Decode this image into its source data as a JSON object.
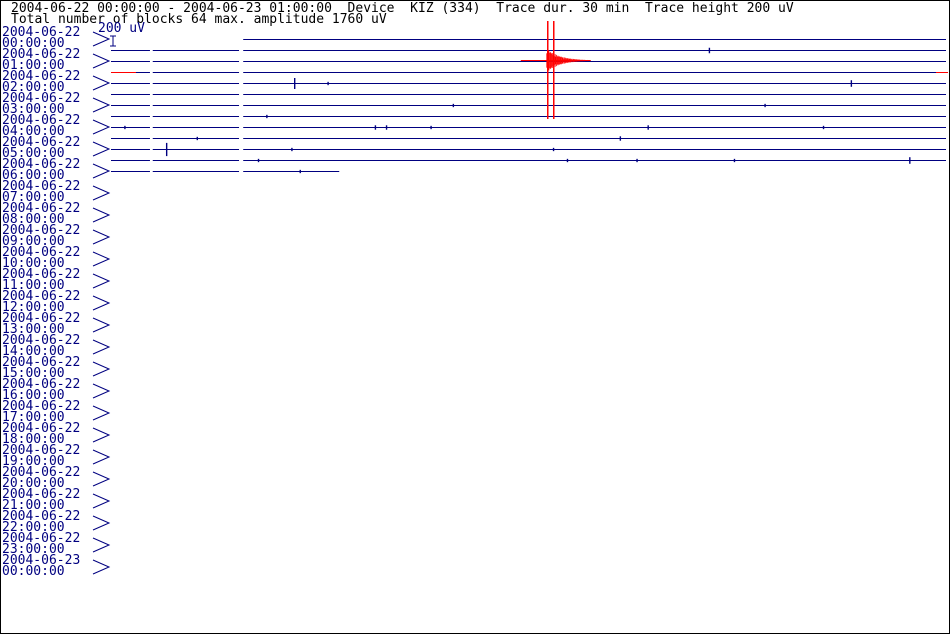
{
  "header": {
    "line1": "2004-06-22 00:00:00 - 2004-06-23 01:00:00  Device  KIZ (334)  Trace dur. 30 min  Trace height 200 uV",
    "line2": "Total number of blocks 64 max. amplitude 1760 uV",
    "scale_label": "200 uV"
  },
  "colors": {
    "trace": "#000080",
    "event": "#ff0000",
    "text": "#000080",
    "border": "#000000",
    "background": "#ffffff"
  },
  "chart_data": {
    "type": "line",
    "title": "2004-06-22 00:00:00 - 2004-06-23 01:00:00  Device  KIZ (334)  Trace dur. 30 min  Trace height 200 uV",
    "subtitle": "Total number of blocks 64 max. amplitude 1760 uV",
    "trace_duration_min": 30,
    "trace_height_uV": 200,
    "max_amplitude_uV": 1760,
    "total_blocks": 64,
    "x_range_min": [
      0,
      30
    ],
    "y_tick_labels": [
      {
        "date": "2004-06-22",
        "time": "00:00:00"
      },
      {
        "date": "2004-06-22",
        "time": "01:00:00"
      },
      {
        "date": "2004-06-22",
        "time": "02:00:00"
      },
      {
        "date": "2004-06-22",
        "time": "03:00:00"
      },
      {
        "date": "2004-06-22",
        "time": "04:00:00"
      },
      {
        "date": "2004-06-22",
        "time": "05:00:00"
      },
      {
        "date": "2004-06-22",
        "time": "06:00:00"
      },
      {
        "date": "2004-06-22",
        "time": "07:00:00"
      },
      {
        "date": "2004-06-22",
        "time": "08:00:00"
      },
      {
        "date": "2004-06-22",
        "time": "09:00:00"
      },
      {
        "date": "2004-06-22",
        "time": "10:00:00"
      },
      {
        "date": "2004-06-22",
        "time": "11:00:00"
      },
      {
        "date": "2004-06-22",
        "time": "12:00:00"
      },
      {
        "date": "2004-06-22",
        "time": "13:00:00"
      },
      {
        "date": "2004-06-22",
        "time": "14:00:00"
      },
      {
        "date": "2004-06-22",
        "time": "15:00:00"
      },
      {
        "date": "2004-06-22",
        "time": "16:00:00"
      },
      {
        "date": "2004-06-22",
        "time": "17:00:00"
      },
      {
        "date": "2004-06-22",
        "time": "18:00:00"
      },
      {
        "date": "2004-06-22",
        "time": "19:00:00"
      },
      {
        "date": "2004-06-22",
        "time": "20:00:00"
      },
      {
        "date": "2004-06-22",
        "time": "21:00:00"
      },
      {
        "date": "2004-06-22",
        "time": "22:00:00"
      },
      {
        "date": "2004-06-22",
        "time": "23:00:00"
      },
      {
        "date": "2004-06-23",
        "time": "00:00:00"
      }
    ],
    "traces": [
      {
        "start_hour": 0.0,
        "end_min": 30,
        "gaps_min": [
          [
            0.0,
            30.0
          ]
        ],
        "spikes": [],
        "event": false
      },
      {
        "start_hour": 0.5,
        "end_min": 30,
        "gaps_min": [],
        "spikes": [
          {
            "t_min": 21.5,
            "amp": 0.25
          }
        ],
        "event": false
      },
      {
        "start_hour": 1.0,
        "end_min": 30,
        "gaps_min": [],
        "spikes": [],
        "event": false
      },
      {
        "start_hour": 1.5,
        "end_min": 30,
        "gaps_min": [],
        "spikes": [],
        "event": false
      },
      {
        "start_hour": 2.0,
        "end_min": 30,
        "gaps_min": [],
        "spikes": [
          {
            "t_min": 6.6,
            "amp": 0.5
          },
          {
            "t_min": 7.8,
            "amp": 0.15
          },
          {
            "t_min": 26.6,
            "amp": 0.3
          }
        ],
        "event": false
      },
      {
        "start_hour": 2.5,
        "end_min": 30,
        "gaps_min": [],
        "spikes": [],
        "event": false
      },
      {
        "start_hour": 3.0,
        "end_min": 30,
        "gaps_min": [],
        "spikes": [
          {
            "t_min": 12.3,
            "amp": 0.15
          },
          {
            "t_min": 23.5,
            "amp": 0.15
          }
        ],
        "event": false
      },
      {
        "start_hour": 3.5,
        "end_min": 30,
        "gaps_min": [],
        "spikes": [
          {
            "t_min": 5.6,
            "amp": 0.15
          }
        ],
        "event": false
      },
      {
        "start_hour": 4.0,
        "end_min": 30,
        "gaps_min": [],
        "spikes": [
          {
            "t_min": 0.5,
            "amp": 0.15
          },
          {
            "t_min": 9.5,
            "amp": 0.2
          },
          {
            "t_min": 9.9,
            "amp": 0.2
          },
          {
            "t_min": 11.5,
            "amp": 0.15
          },
          {
            "t_min": 19.3,
            "amp": 0.2
          },
          {
            "t_min": 25.6,
            "amp": 0.15
          }
        ],
        "event": false
      },
      {
        "start_hour": 4.5,
        "end_min": 30,
        "gaps_min": [],
        "spikes": [
          {
            "t_min": 3.1,
            "amp": 0.15
          },
          {
            "t_min": 18.3,
            "amp": 0.2
          }
        ],
        "event": false
      },
      {
        "start_hour": 5.0,
        "end_min": 30,
        "gaps_min": [],
        "spikes": [
          {
            "t_min": 2.0,
            "amp": 0.6
          },
          {
            "t_min": 6.5,
            "amp": 0.15
          },
          {
            "t_min": 15.9,
            "amp": 0.15
          }
        ],
        "event": false
      },
      {
        "start_hour": 5.5,
        "end_min": 30,
        "gaps_min": [],
        "spikes": [
          {
            "t_min": 5.3,
            "amp": 0.15
          },
          {
            "t_min": 16.4,
            "amp": 0.15
          },
          {
            "t_min": 18.9,
            "amp": 0.15
          },
          {
            "t_min": 22.4,
            "amp": 0.15
          },
          {
            "t_min": 28.7,
            "amp": 0.3
          }
        ],
        "event": false
      },
      {
        "start_hour": 6.0,
        "end_min": 8.2,
        "gaps_min": [],
        "spikes": [
          {
            "t_min": 6.8,
            "amp": 0.15
          }
        ],
        "event": false
      }
    ],
    "events": [
      {
        "label": "",
        "hour": 1.5,
        "t_min": 15.8,
        "amp_uV": 1760
      }
    ]
  }
}
